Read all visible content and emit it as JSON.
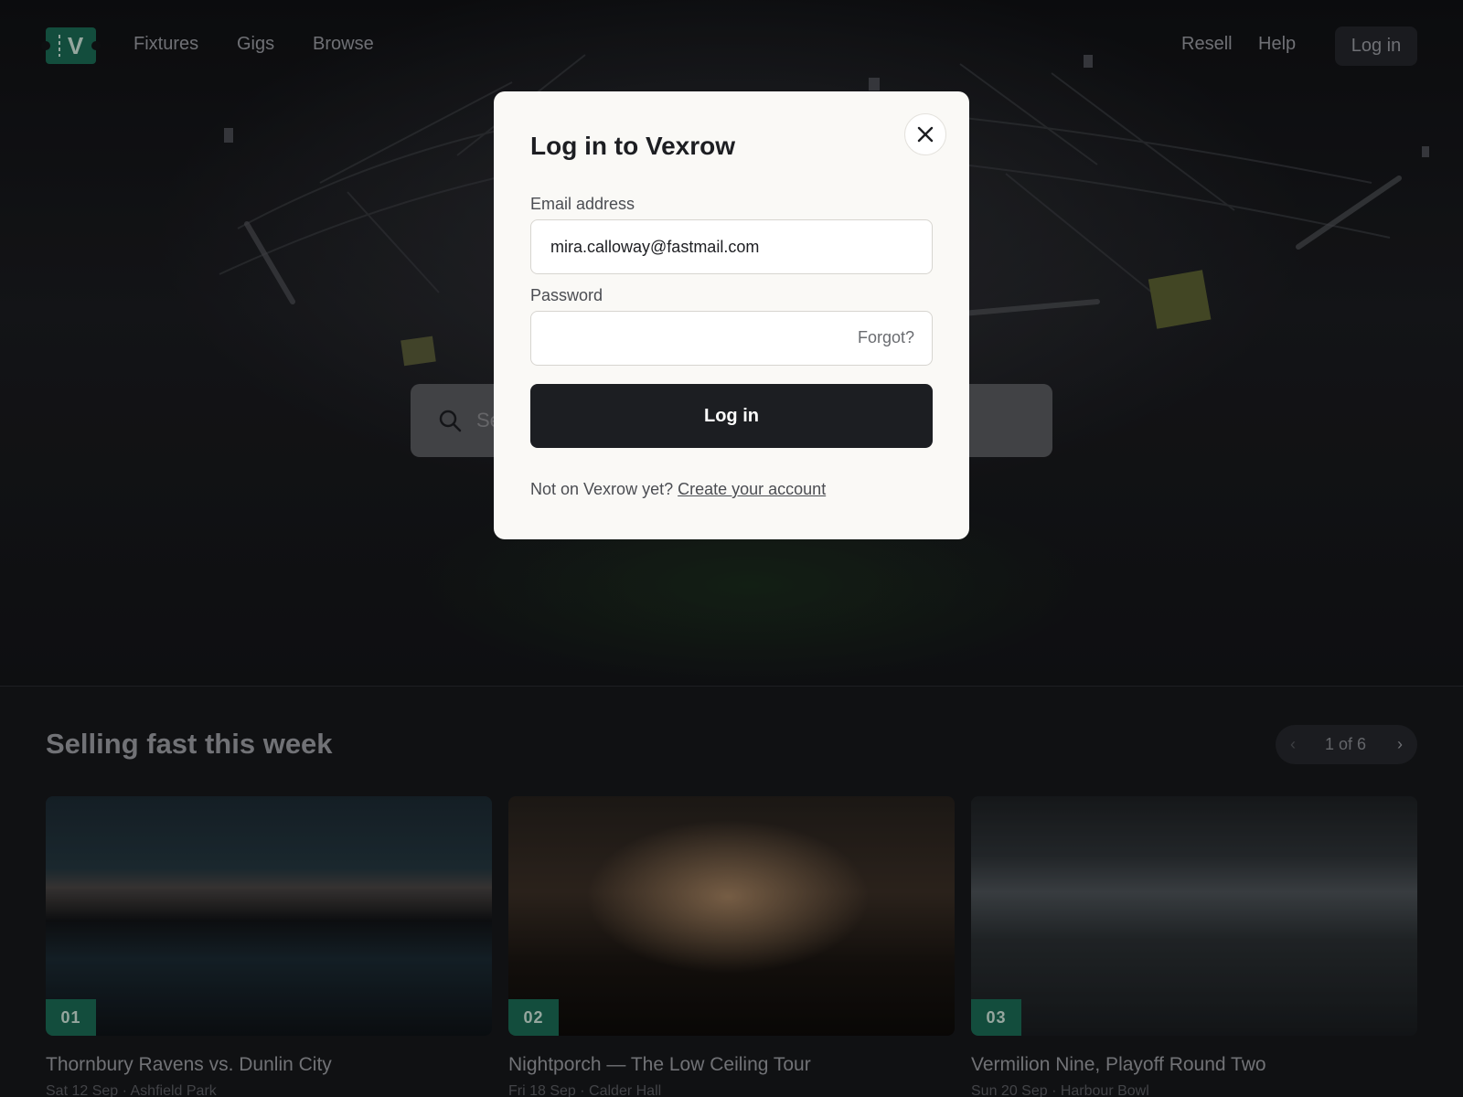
{
  "nav": {
    "logo_letter": "V",
    "links": [
      "Fixtures",
      "Gigs",
      "Browse"
    ],
    "right_links": [
      "Resell",
      "Help"
    ],
    "login_label": "Log in"
  },
  "hero": {
    "search_placeholder_visible": "Se"
  },
  "section": {
    "title": "Selling fast this week",
    "pager": {
      "label": "1 of 6",
      "prev_icon": "chevron-left-icon",
      "next_icon": "chevron-right-icon"
    },
    "cards": [
      {
        "rank": "01",
        "title": "Thornbury Ravens vs. Dunlin City",
        "meta": "Sat 12 Sep · Ashfield Park"
      },
      {
        "rank": "02",
        "title": "Nightporch — The Low Ceiling Tour",
        "meta": "Fri 18 Sep · Calder Hall"
      },
      {
        "rank": "03",
        "title": "Vermilion Nine, Playoff Round Two",
        "meta": "Sun 20 Sep · Harbour Bowl"
      }
    ]
  },
  "modal": {
    "title": "Log in to Vexrow",
    "email_label": "Email address",
    "email_value": "mira.calloway@fastmail.com",
    "password_label": "Password",
    "password_value": "",
    "forgot_label": "Forgot?",
    "submit_label": "Log in",
    "signup_prompt": "Not on Vexrow yet?",
    "signup_link": "Create your account"
  },
  "colors": {
    "brand_green": "#1b6b55",
    "modal_bg": "#faf9f6",
    "button_dark": "#1c1e22"
  }
}
